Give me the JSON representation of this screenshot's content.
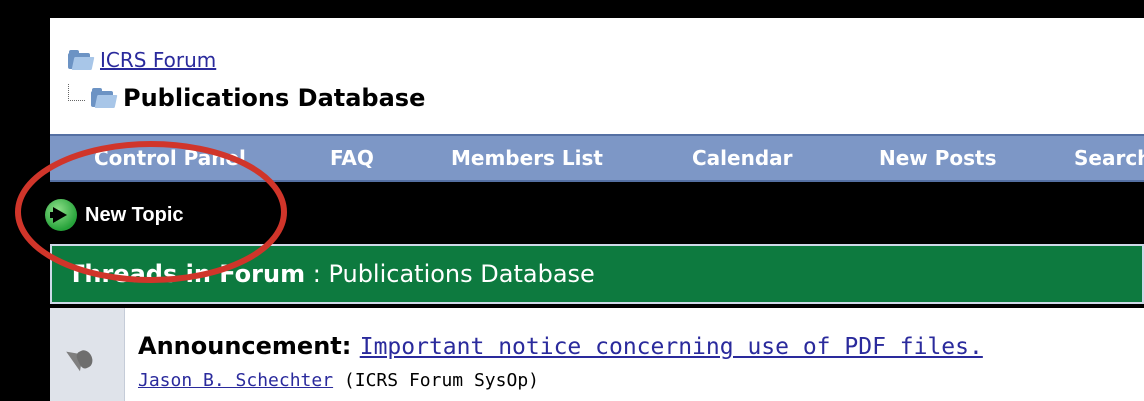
{
  "breadcrumb": {
    "parent_label": "ICRS Forum",
    "current_label": "Publications Database"
  },
  "nav": {
    "items": [
      {
        "label": "Control Panel"
      },
      {
        "label": "FAQ"
      },
      {
        "label": "Members List"
      },
      {
        "label": "Calendar"
      },
      {
        "label": "New Posts"
      },
      {
        "label": "Search"
      }
    ]
  },
  "actions": {
    "new_topic_label": "New Topic"
  },
  "threads_header": {
    "label": "Threads in Forum",
    "separator": " : ",
    "forum_name": "Publications Database"
  },
  "announcement": {
    "prefix": "Announcement",
    "title": "Important notice concerning use of PDF files.",
    "author": "Jason B. Schechter",
    "author_role": "(ICRS Forum SysOp)"
  },
  "colors": {
    "nav_bg": "#7d97c6",
    "threads_bg": "#0d7a3f",
    "link": "#2a2a9c",
    "highlight": "#d0352a"
  },
  "icons": [
    "folder-icon",
    "folder-open-icon",
    "tree-connector-icon",
    "go-arrow-icon",
    "megaphone-icon"
  ]
}
